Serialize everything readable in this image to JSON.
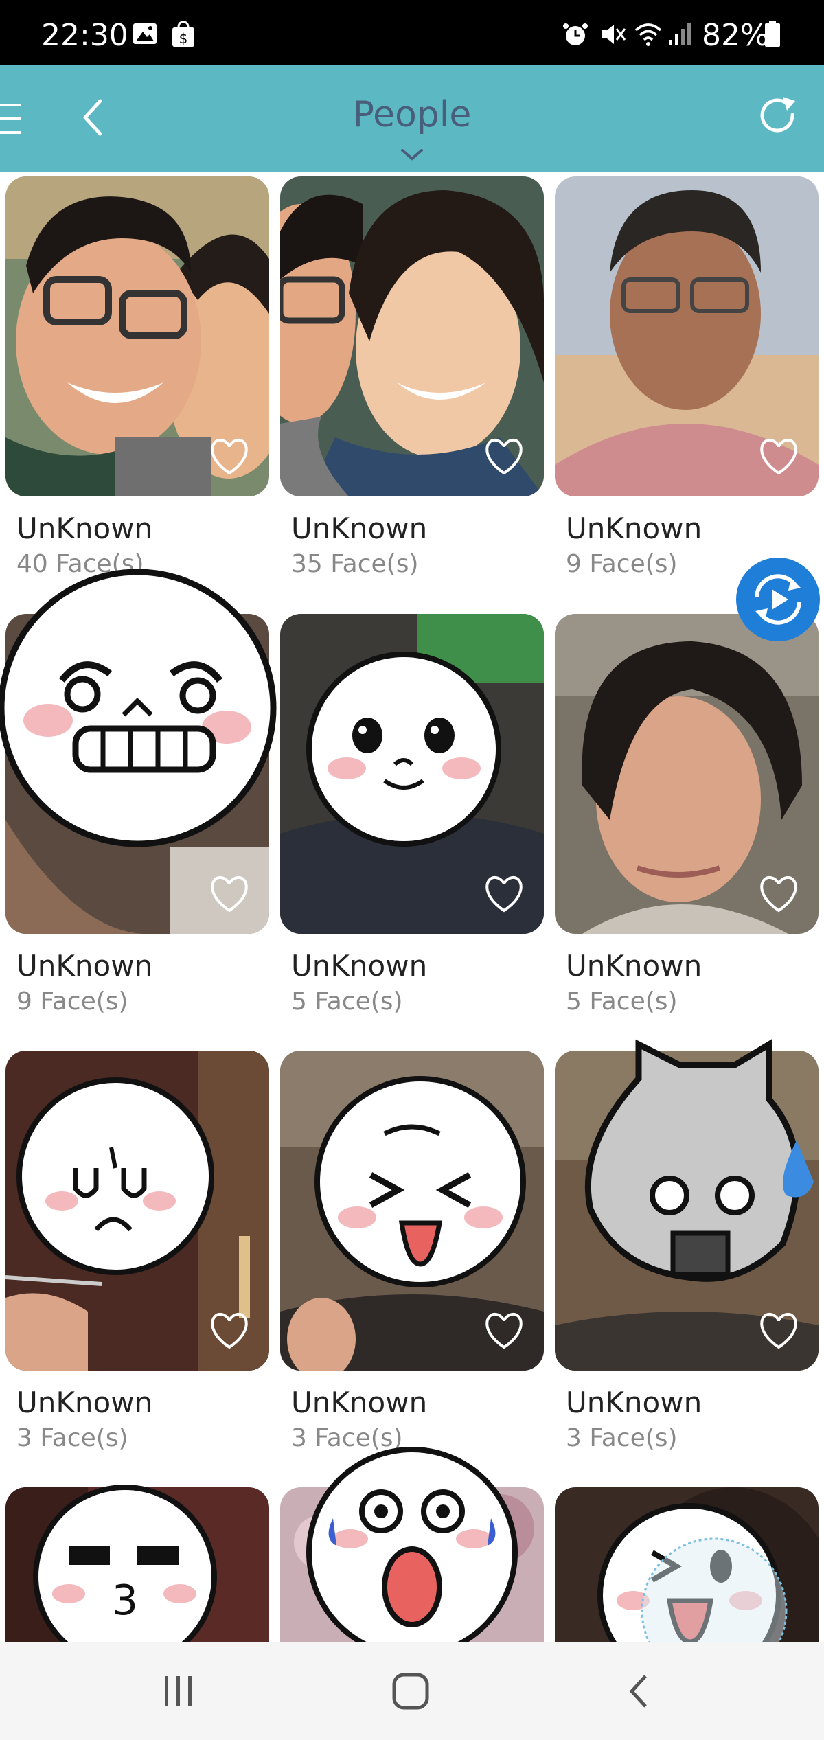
{
  "status_bar": {
    "time": "22:30",
    "battery": "82%"
  },
  "header": {
    "title": "People"
  },
  "people": [
    {
      "name": "UnKnown",
      "faces": "40 Face(s)"
    },
    {
      "name": "UnKnown",
      "faces": "35 Face(s)"
    },
    {
      "name": "UnKnown",
      "faces": "9 Face(s)"
    },
    {
      "name": "UnKnown",
      "faces": "9 Face(s)"
    },
    {
      "name": "UnKnown",
      "faces": "5 Face(s)"
    },
    {
      "name": "UnKnown",
      "faces": "5 Face(s)"
    },
    {
      "name": "UnKnown",
      "faces": "3 Face(s)"
    },
    {
      "name": "UnKnown",
      "faces": "3 Face(s)"
    },
    {
      "name": "UnKnown",
      "faces": "3 Face(s)"
    }
  ],
  "colors": {
    "accent": "#5cb9c4",
    "title": "#485e7a",
    "fab": "#1f7fd8"
  }
}
